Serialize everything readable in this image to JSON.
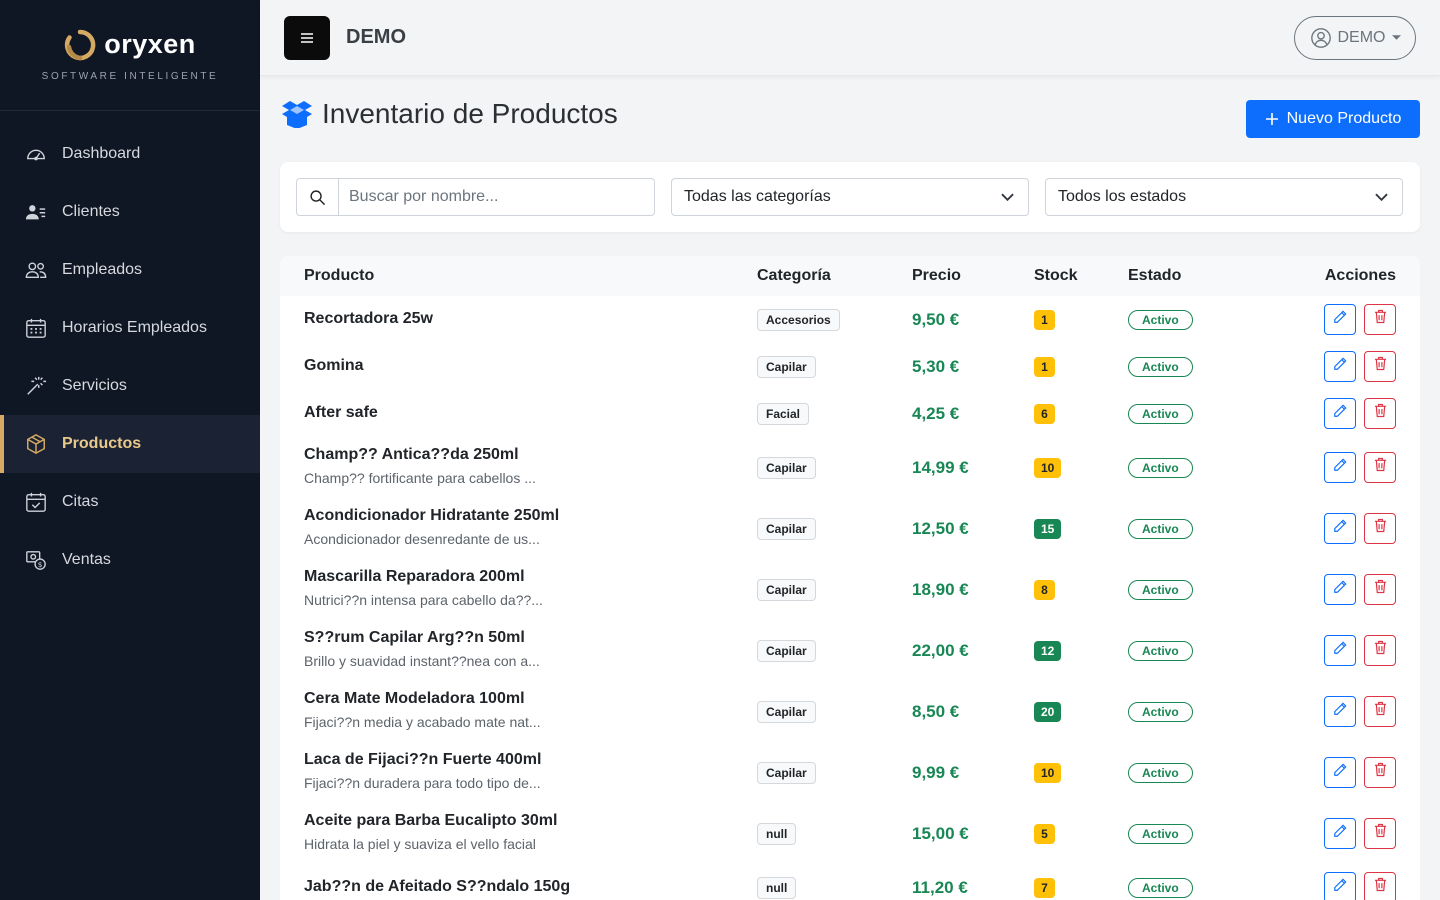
{
  "brand": {
    "name": "oryxen",
    "tagline": "SOFTWARE INTELIGENTE"
  },
  "sidebar": {
    "items": [
      {
        "label": "Dashboard",
        "icon": "speedometer-icon"
      },
      {
        "label": "Clientes",
        "icon": "person-lines-icon"
      },
      {
        "label": "Empleados",
        "icon": "people-icon"
      },
      {
        "label": "Horarios Empleados",
        "icon": "calendar-grid-icon"
      },
      {
        "label": "Servicios",
        "icon": "magic-wand-icon"
      },
      {
        "label": "Productos",
        "icon": "box-icon",
        "active": true
      },
      {
        "label": "Citas",
        "icon": "calendar-check-icon"
      },
      {
        "label": "Ventas",
        "icon": "cash-coin-icon"
      }
    ]
  },
  "topbar": {
    "title": "DEMO",
    "user": "DEMO"
  },
  "page": {
    "title": "Inventario de Productos",
    "new_button": "Nuevo Producto"
  },
  "filters": {
    "search_placeholder": "Buscar por nombre...",
    "category_selected": "Todas las categorías",
    "status_selected": "Todos los estados"
  },
  "table": {
    "headers": {
      "product": "Producto",
      "category": "Categoría",
      "price": "Precio",
      "stock": "Stock",
      "status": "Estado",
      "actions": "Acciones"
    },
    "rows": [
      {
        "name": "Recortadora 25w",
        "desc": "",
        "category": "Accesorios",
        "price": "9,50 €",
        "stock": "1",
        "stock_level": "low",
        "status": "Activo"
      },
      {
        "name": "Gomina",
        "desc": "",
        "category": "Capilar",
        "price": "5,30 €",
        "stock": "1",
        "stock_level": "low",
        "status": "Activo"
      },
      {
        "name": "After safe",
        "desc": "",
        "category": "Facial",
        "price": "4,25 €",
        "stock": "6",
        "stock_level": "low",
        "status": "Activo"
      },
      {
        "name": "Champ?? Antica??da 250ml",
        "desc": "Champ?? fortificante para cabellos ...",
        "category": "Capilar",
        "price": "14,99 €",
        "stock": "10",
        "stock_level": "low",
        "status": "Activo"
      },
      {
        "name": "Acondicionador Hidratante 250ml",
        "desc": "Acondicionador desenredante de us...",
        "category": "Capilar",
        "price": "12,50 €",
        "stock": "15",
        "stock_level": "ok",
        "status": "Activo"
      },
      {
        "name": "Mascarilla Reparadora 200ml",
        "desc": "Nutrici??n intensa para cabello da??...",
        "category": "Capilar",
        "price": "18,90 €",
        "stock": "8",
        "stock_level": "low",
        "status": "Activo"
      },
      {
        "name": "S??rum Capilar Arg??n 50ml",
        "desc": "Brillo y suavidad instant??nea con a...",
        "category": "Capilar",
        "price": "22,00 €",
        "stock": "12",
        "stock_level": "ok",
        "status": "Activo"
      },
      {
        "name": "Cera Mate Modeladora 100ml",
        "desc": "Fijaci??n media y acabado mate nat...",
        "category": "Capilar",
        "price": "8,50 €",
        "stock": "20",
        "stock_level": "ok",
        "status": "Activo"
      },
      {
        "name": "Laca de Fijaci??n Fuerte 400ml",
        "desc": "Fijaci??n duradera para todo tipo de...",
        "category": "Capilar",
        "price": "9,99 €",
        "stock": "10",
        "stock_level": "low",
        "status": "Activo"
      },
      {
        "name": "Aceite para Barba Eucalipto 30ml",
        "desc": "Hidrata la piel y suaviza el vello facial",
        "category": "null",
        "price": "15,00 €",
        "stock": "5",
        "stock_level": "low",
        "status": "Activo"
      },
      {
        "name": "Jab??n de Afeitado S??ndalo 150g",
        "desc": "",
        "category": "null",
        "price": "11,20 €",
        "stock": "7",
        "stock_level": "low",
        "status": "Activo"
      }
    ]
  },
  "colors": {
    "sidebar_bg": "#0f1624",
    "accent_gold": "#d6aa63",
    "primary": "#0d6efd",
    "success": "#198754",
    "warning": "#ffc107",
    "danger": "#dc3545"
  }
}
